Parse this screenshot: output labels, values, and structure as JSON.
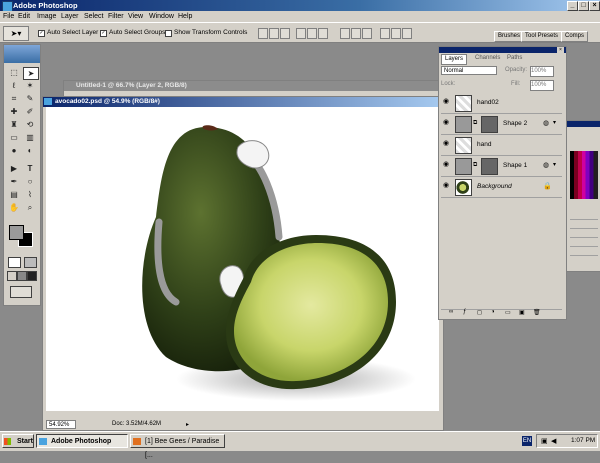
{
  "app": {
    "title": "Adobe Photoshop"
  },
  "window_buttons": {
    "minimize": "_",
    "maximize": "□",
    "close": "×"
  },
  "menu": [
    "File",
    "Edit",
    "Image",
    "Layer",
    "Select",
    "Filter",
    "View",
    "Window",
    "Help"
  ],
  "options": {
    "auto_select_layer": "Auto Select Layer",
    "auto_select_groups": "Auto Select Groups",
    "show_transform_controls": "Show Transform Controls",
    "dock_tabs": [
      "Brushes",
      "Tool Presets",
      "Comps"
    ]
  },
  "documents": [
    {
      "title": "Untitled-1 @ 66.7% (Layer 2, RGB/8)"
    },
    {
      "title": "avocado02.psd @ 54.9% (RGB/8#)"
    }
  ],
  "status": {
    "zoom": "54.92%",
    "doc_size": "Doc: 3.52M/4.62M"
  },
  "layers_panel": {
    "tabs": [
      "Layers",
      "Channels",
      "Paths"
    ],
    "blend_mode": "Normal",
    "opacity_label": "Opacity:",
    "opacity_value": "100%",
    "lock_label": "Lock:",
    "fill_label": "Fill:",
    "fill_value": "100%",
    "layers": [
      {
        "name": "hand02"
      },
      {
        "name": "Shape 2"
      },
      {
        "name": "hand"
      },
      {
        "name": "Shape 1"
      },
      {
        "name": "Background"
      }
    ]
  },
  "taskbar": {
    "start": "Start",
    "items": [
      "Adobe Photoshop",
      "[1] Bee Gees / Paradise [..."
    ],
    "lang": "EN",
    "clock": "1:07 PM"
  },
  "colors": {
    "titlebar": "#0a246a",
    "avocado_skin": "#2f4018",
    "avocado_flesh": "#d4e080"
  }
}
